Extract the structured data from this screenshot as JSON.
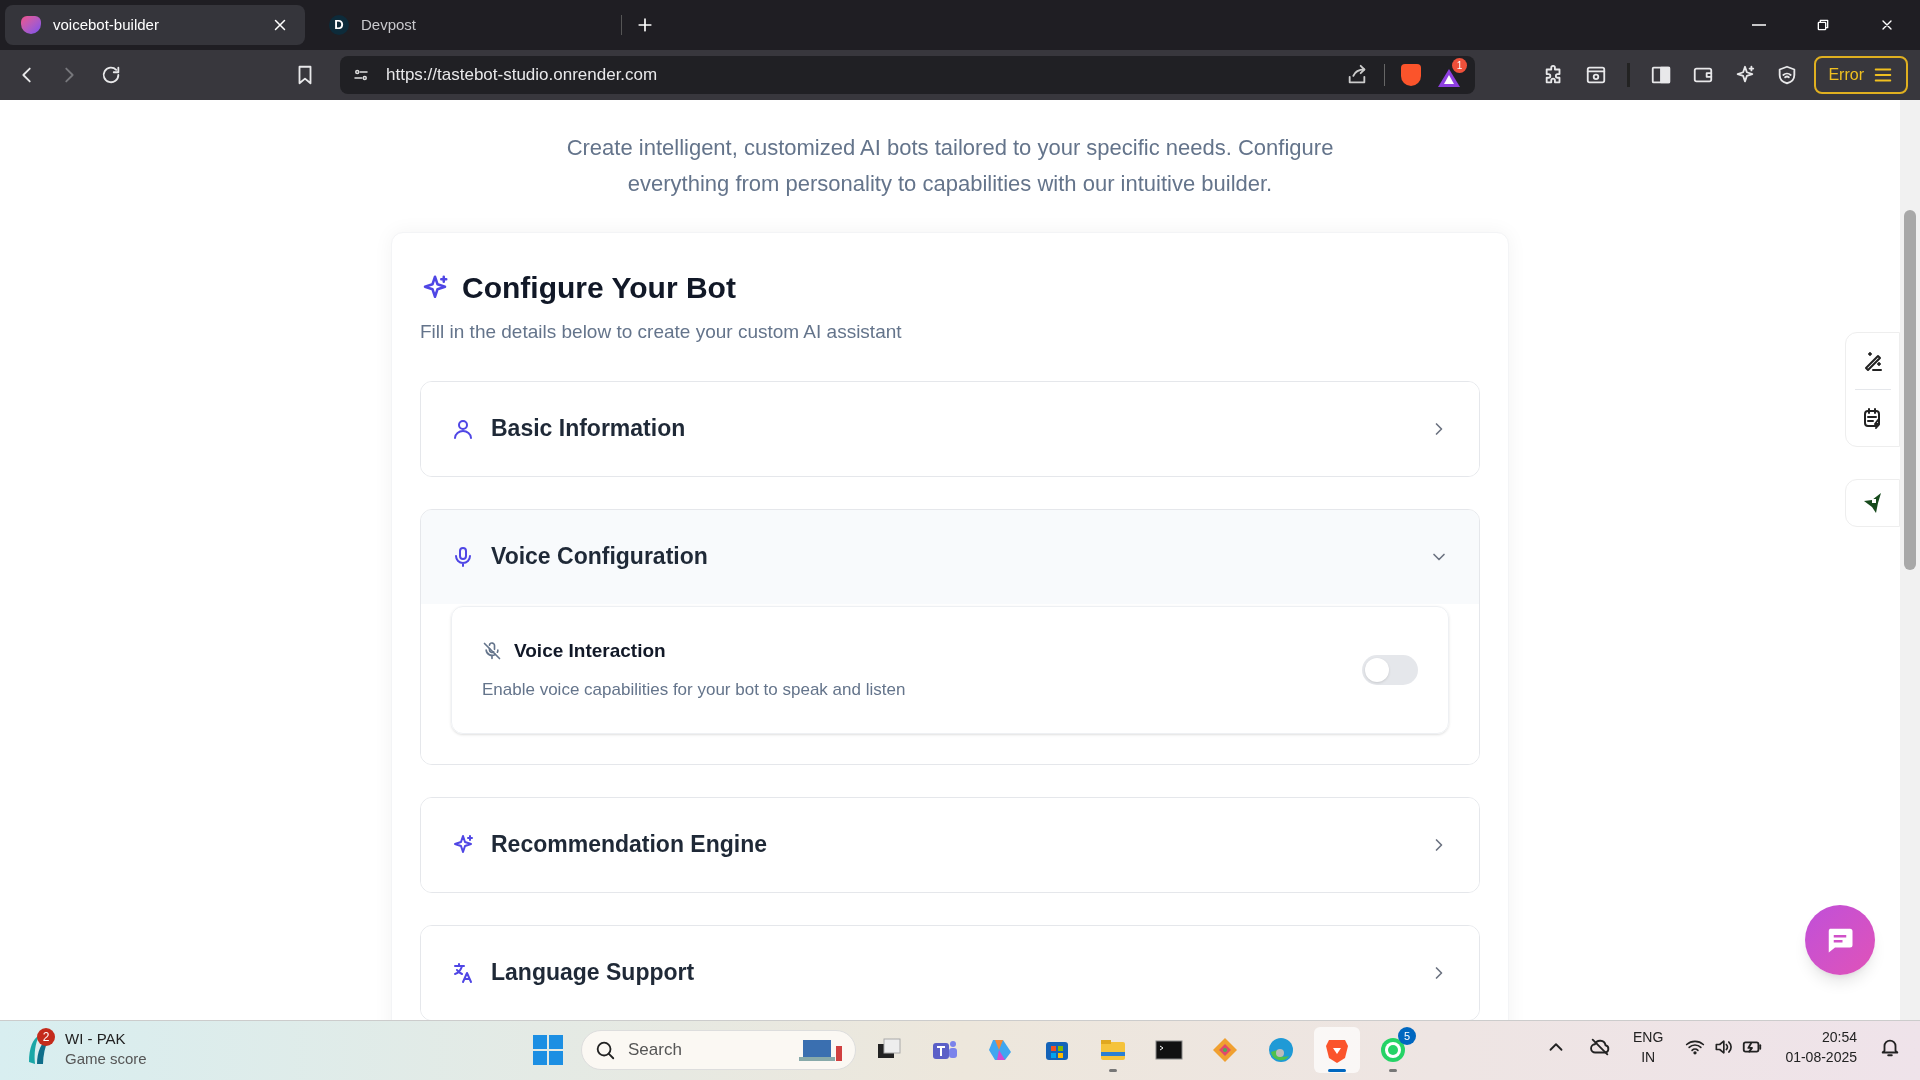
{
  "browser": {
    "tabs": [
      {
        "title": "voicebot-builder",
        "selected": true,
        "kind": "app"
      },
      {
        "title": "Devpost",
        "selected": false,
        "kind": "devpost",
        "favicon_letter": "D"
      }
    ],
    "url": "https://tastebot-studio.onrender.com",
    "shield_badge": "1",
    "error_button": "Error"
  },
  "page": {
    "intro": "Create intelligent, customized AI bots tailored to your specific needs. Configure everything from personality to capabilities with our intuitive builder.",
    "title": "Configure Your Bot",
    "subtitle": "Fill in the details below to create your custom AI assistant",
    "sections": [
      {
        "title": "Basic Information",
        "kind": "user",
        "expanded": false
      },
      {
        "title": "Voice Configuration",
        "kind": "mic",
        "expanded": true,
        "settings": [
          {
            "title": "Voice Interaction",
            "description": "Enable voice capabilities for your bot to speak and listen",
            "on": false
          }
        ]
      },
      {
        "title": "Recommendation Engine",
        "kind": "sparkles",
        "expanded": false
      },
      {
        "title": "Language Support",
        "kind": "languages",
        "expanded": false
      }
    ]
  },
  "taskbar": {
    "widget": {
      "title": "WI - PAK",
      "subtitle": "Game score",
      "badge": "2"
    },
    "search_placeholder": "Search",
    "apps": [
      {
        "kind": "taskview",
        "running": false,
        "selected": false
      },
      {
        "kind": "teams",
        "running": false,
        "selected": false
      },
      {
        "kind": "copilot",
        "running": false,
        "selected": false
      },
      {
        "kind": "store",
        "running": false,
        "selected": false
      },
      {
        "kind": "explorer",
        "running": true,
        "selected": false
      },
      {
        "kind": "terminal",
        "running": false,
        "selected": false
      },
      {
        "kind": "git",
        "running": false,
        "selected": false
      },
      {
        "kind": "edge",
        "running": false,
        "selected": false
      },
      {
        "kind": "brave",
        "running": true,
        "selected": true
      },
      {
        "kind": "whatsapp",
        "running": true,
        "selected": false,
        "badge": "5"
      }
    ],
    "language": "ENG",
    "region": "IN",
    "time": "20:54",
    "date": "01-08-2025"
  }
}
